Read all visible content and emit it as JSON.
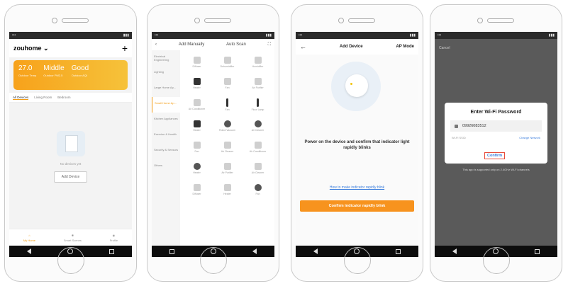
{
  "colors": {
    "accent": "#f7931e",
    "link": "#3b7ddd",
    "highlight": "#e74c3c"
  },
  "screen1": {
    "home_name": "zouhome",
    "weather": [
      {
        "value": "27.0",
        "label": "Outdoor Temp"
      },
      {
        "value": "Middle",
        "label": "Outdoor PM2.5"
      },
      {
        "value": "Good",
        "label": "Outdoor AQI"
      }
    ],
    "room_tabs": [
      "All Devices",
      "Living Room",
      "Bedroom"
    ],
    "empty_text": "No devices yet",
    "add_button": "Add Device",
    "bottom_tabs": [
      "My Home",
      "Smart Scenes",
      "Profile"
    ]
  },
  "screen2": {
    "tab_manual": "Add Manually",
    "tab_auto": "Auto Scan",
    "categories": [
      "Electrical Engineering",
      "Lighting",
      "Large Home Ap...",
      "Small Home Ap...",
      "Kitchen Appliances",
      "Exercise & Health",
      "Security & Sensors",
      "Others"
    ],
    "items": [
      "Diffuser",
      "Dehumidifier",
      "Humidifier",
      "Heater",
      "Fan",
      "Air Purifier",
      "Air Conditioner",
      "Fan",
      "Floor Lamp",
      "Heater",
      "Robot Vacuum",
      "Air Cleaner",
      "Fan",
      "Air Cleaner",
      "Air Conditioner",
      "Heater",
      "Air Purifier",
      "Air Cleaner",
      "Diffuser",
      "Heater",
      "Fan"
    ]
  },
  "screen3": {
    "title": "Add Device",
    "mode": "AP Mode",
    "instruction": "Power on the device and confirm that indicator light rapidly blinks",
    "help_link": "How to make indicator rapidly blink",
    "confirm_button": "Confirm indicator rapidly blink"
  },
  "screen4": {
    "cancel": "Cancel",
    "dialog_title": "Enter Wi-Fi Password",
    "password": "09926083512",
    "wifi_label": "Wi-Fi SSID",
    "change_network": "Change Network",
    "confirm": "Confirm",
    "note": "This app is supported only on 2.4GHz Wi-Fi channels"
  }
}
